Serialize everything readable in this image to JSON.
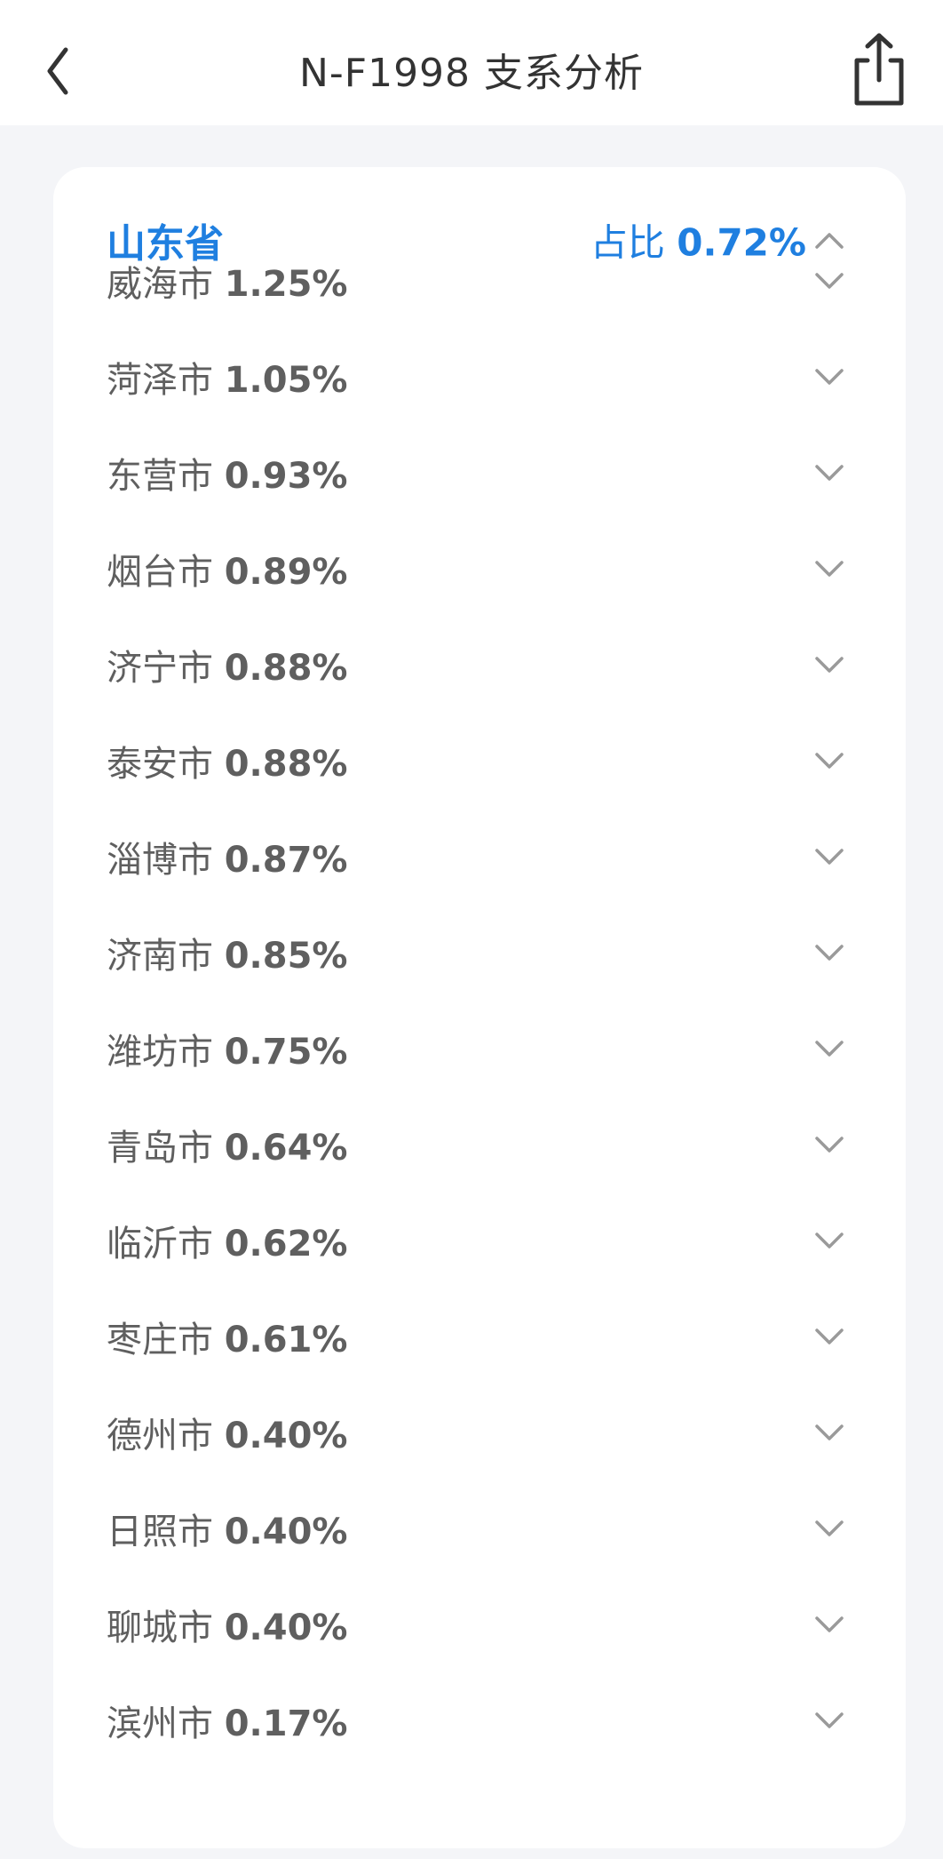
{
  "nav": {
    "title": "N-F1998 支系分析"
  },
  "province": {
    "name": "山东省",
    "ratio_label": "占比",
    "ratio_value": "0.72%",
    "accent_color": "#1f7fe0",
    "expanded": true
  },
  "cities": [
    {
      "name": "威海市",
      "pct": "1.25%"
    },
    {
      "name": "菏泽市",
      "pct": "1.05%"
    },
    {
      "name": "东营市",
      "pct": "0.93%"
    },
    {
      "name": "烟台市",
      "pct": "0.89%"
    },
    {
      "name": "济宁市",
      "pct": "0.88%"
    },
    {
      "name": "泰安市",
      "pct": "0.88%"
    },
    {
      "name": "淄博市",
      "pct": "0.87%"
    },
    {
      "name": "济南市",
      "pct": "0.85%"
    },
    {
      "name": "潍坊市",
      "pct": "0.75%"
    },
    {
      "name": "青岛市",
      "pct": "0.64%"
    },
    {
      "name": "临沂市",
      "pct": "0.62%"
    },
    {
      "name": "枣庄市",
      "pct": "0.61%"
    },
    {
      "name": "德州市",
      "pct": "0.40%"
    },
    {
      "name": "日照市",
      "pct": "0.40%"
    },
    {
      "name": "聊城市",
      "pct": "0.40%"
    },
    {
      "name": "滨州市",
      "pct": "0.17%"
    }
  ],
  "icons": {
    "back": "chevron-left-icon",
    "share": "share-icon",
    "collapse": "chevron-up-icon",
    "expand": "chevron-down-icon"
  }
}
